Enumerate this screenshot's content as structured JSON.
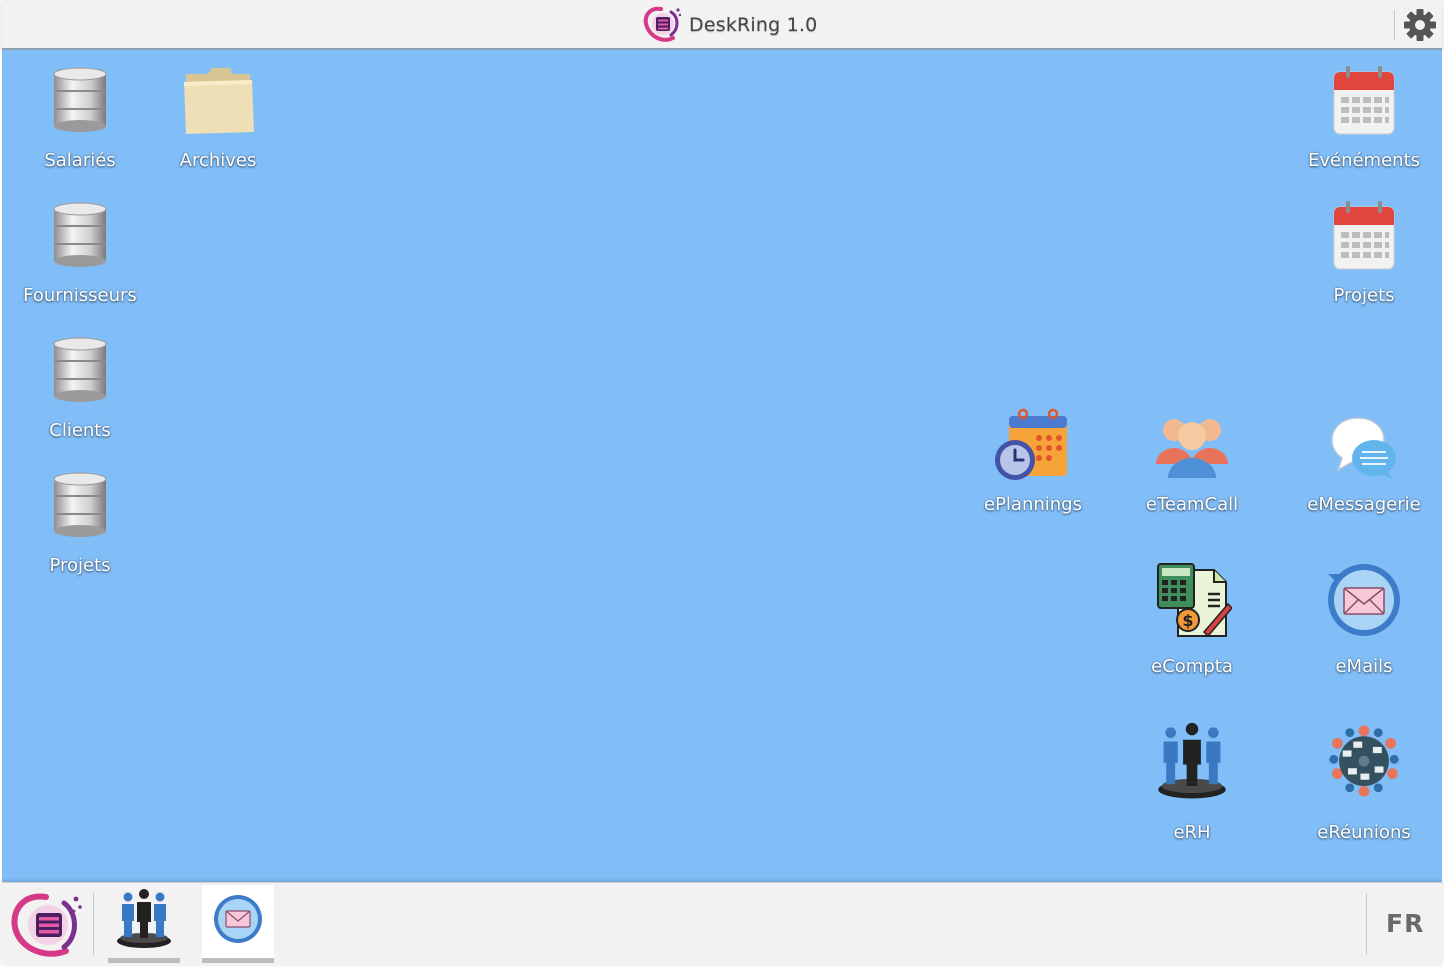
{
  "header": {
    "app_title": "DeskRing 1.0",
    "logo_icon": "deskring-logo-icon",
    "settings_icon": "gear-icon"
  },
  "desktop": {
    "background_color": "#81bdf7",
    "left_icons": [
      {
        "label": "Salariés",
        "icon": "database-icon"
      },
      {
        "label": "Archives",
        "icon": "folder-icon"
      },
      {
        "label": "Fournisseurs",
        "icon": "database-icon"
      },
      {
        "label": "Clients",
        "icon": "database-icon"
      },
      {
        "label": "Projets",
        "icon": "database-icon"
      }
    ],
    "right_icons": [
      {
        "label": "Evénéments",
        "icon": "calendar-icon"
      },
      {
        "label": "Projets",
        "icon": "calendar-icon"
      }
    ],
    "apps": [
      {
        "label": "ePlannings",
        "icon": "planning-calendar-icon"
      },
      {
        "label": "eTeamCall",
        "icon": "team-call-icon"
      },
      {
        "label": "eMessagerie",
        "icon": "chat-bubbles-icon"
      },
      {
        "label": "eCompta",
        "icon": "accounting-icon"
      },
      {
        "label": "eMails",
        "icon": "mail-icon"
      },
      {
        "label": "eRH",
        "icon": "people-icon"
      },
      {
        "label": "eRéunions",
        "icon": "meeting-table-icon"
      }
    ]
  },
  "taskbar": {
    "start_icon": "deskring-logo-icon",
    "open_apps": [
      {
        "name": "eRH",
        "icon": "people-icon"
      },
      {
        "name": "eMails",
        "icon": "mail-icon",
        "active": true
      }
    ],
    "language": "FR"
  }
}
